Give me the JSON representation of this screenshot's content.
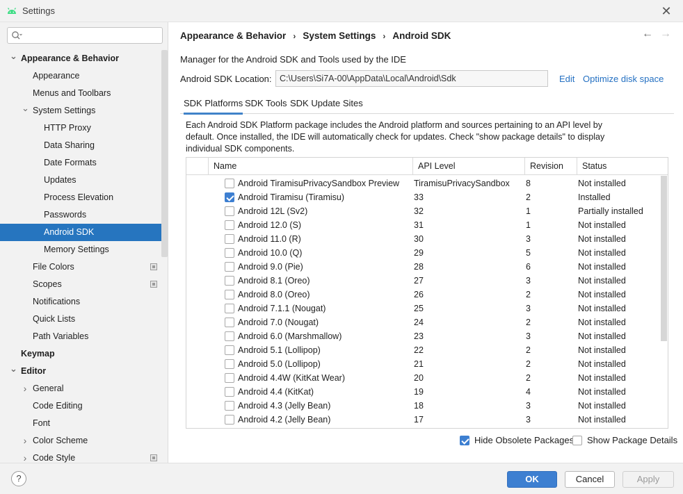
{
  "window": {
    "title": "Settings",
    "close_glyph": "✕"
  },
  "search": {
    "placeholder": "",
    "value": ""
  },
  "sidebar": {
    "items": [
      {
        "label": "Appearance & Behavior",
        "level": 0,
        "arrow": "expanded",
        "bold": true
      },
      {
        "label": "Appearance",
        "level": 1
      },
      {
        "label": "Menus and Toolbars",
        "level": 1
      },
      {
        "label": "System Settings",
        "level": 1,
        "arrow": "expanded"
      },
      {
        "label": "HTTP Proxy",
        "level": 2
      },
      {
        "label": "Data Sharing",
        "level": 2
      },
      {
        "label": "Date Formats",
        "level": 2
      },
      {
        "label": "Updates",
        "level": 2
      },
      {
        "label": "Process Elevation",
        "level": 2
      },
      {
        "label": "Passwords",
        "level": 2
      },
      {
        "label": "Android SDK",
        "level": 2,
        "selected": true
      },
      {
        "label": "Memory Settings",
        "level": 2
      },
      {
        "label": "File Colors",
        "level": 1,
        "badge": true
      },
      {
        "label": "Scopes",
        "level": 1,
        "badge": true
      },
      {
        "label": "Notifications",
        "level": 1
      },
      {
        "label": "Quick Lists",
        "level": 1
      },
      {
        "label": "Path Variables",
        "level": 1
      },
      {
        "label": "Keymap",
        "level": 0,
        "bold": true
      },
      {
        "label": "Editor",
        "level": 0,
        "arrow": "expanded",
        "bold": true
      },
      {
        "label": "General",
        "level": 1,
        "arrow": "collapsed"
      },
      {
        "label": "Code Editing",
        "level": 1
      },
      {
        "label": "Font",
        "level": 1
      },
      {
        "label": "Color Scheme",
        "level": 1,
        "arrow": "collapsed"
      },
      {
        "label": "Code Style",
        "level": 1,
        "arrow": "collapsed",
        "badge": true
      }
    ]
  },
  "breadcrumb": {
    "part1": "Appearance & Behavior",
    "part2": "System Settings",
    "part3": "Android SDK",
    "sep": "›"
  },
  "nav": {
    "back": "←",
    "forward": "→"
  },
  "main": {
    "description": "Manager for the Android SDK and Tools used by the IDE",
    "location_label": "Android SDK Location:",
    "location_value": "C:\\Users\\Si7A-00\\AppData\\Local\\Android\\Sdk",
    "edit_link": "Edit",
    "optimize_link": "Optimize disk space",
    "tabs": [
      "SDK Platforms",
      "SDK Tools",
      "SDK Update Sites"
    ],
    "panel_description": "Each Android SDK Platform package includes the Android platform and sources pertaining to an API level by default. Once installed, the IDE will automatically check for updates. Check \"show package details\" to display individual SDK components."
  },
  "table": {
    "columns": [
      "Name",
      "API Level",
      "Revision",
      "Status"
    ],
    "rows": [
      {
        "checked": false,
        "name": "Android TiramisuPrivacySandbox Preview",
        "api": "TiramisuPrivacySandbox",
        "revision": "8",
        "status": "Not installed"
      },
      {
        "checked": true,
        "name": "Android Tiramisu (Tiramisu)",
        "api": "33",
        "revision": "2",
        "status": "Installed"
      },
      {
        "checked": false,
        "name": "Android 12L (Sv2)",
        "api": "32",
        "revision": "1",
        "status": "Partially installed"
      },
      {
        "checked": false,
        "name": "Android 12.0 (S)",
        "api": "31",
        "revision": "1",
        "status": "Not installed"
      },
      {
        "checked": false,
        "name": "Android 11.0 (R)",
        "api": "30",
        "revision": "3",
        "status": "Not installed"
      },
      {
        "checked": false,
        "name": "Android 10.0 (Q)",
        "api": "29",
        "revision": "5",
        "status": "Not installed"
      },
      {
        "checked": false,
        "name": "Android 9.0 (Pie)",
        "api": "28",
        "revision": "6",
        "status": "Not installed"
      },
      {
        "checked": false,
        "name": "Android 8.1 (Oreo)",
        "api": "27",
        "revision": "3",
        "status": "Not installed"
      },
      {
        "checked": false,
        "name": "Android 8.0 (Oreo)",
        "api": "26",
        "revision": "2",
        "status": "Not installed"
      },
      {
        "checked": false,
        "name": "Android 7.1.1 (Nougat)",
        "api": "25",
        "revision": "3",
        "status": "Not installed"
      },
      {
        "checked": false,
        "name": "Android 7.0 (Nougat)",
        "api": "24",
        "revision": "2",
        "status": "Not installed"
      },
      {
        "checked": false,
        "name": "Android 6.0 (Marshmallow)",
        "api": "23",
        "revision": "3",
        "status": "Not installed"
      },
      {
        "checked": false,
        "name": "Android 5.1 (Lollipop)",
        "api": "22",
        "revision": "2",
        "status": "Not installed"
      },
      {
        "checked": false,
        "name": "Android 5.0 (Lollipop)",
        "api": "21",
        "revision": "2",
        "status": "Not installed"
      },
      {
        "checked": false,
        "name": "Android 4.4W (KitKat Wear)",
        "api": "20",
        "revision": "2",
        "status": "Not installed"
      },
      {
        "checked": false,
        "name": "Android 4.4 (KitKat)",
        "api": "19",
        "revision": "4",
        "status": "Not installed"
      },
      {
        "checked": false,
        "name": "Android 4.3 (Jelly Bean)",
        "api": "18",
        "revision": "3",
        "status": "Not installed"
      },
      {
        "checked": false,
        "name": "Android 4.2 (Jelly Bean)",
        "api": "17",
        "revision": "3",
        "status": "Not installed"
      }
    ]
  },
  "options": {
    "hide_obsolete": {
      "label": "Hide Obsolete Packages",
      "checked": true
    },
    "show_details": {
      "label": "Show Package Details",
      "checked": false
    }
  },
  "footer": {
    "help": "?",
    "ok": "OK",
    "cancel": "Cancel",
    "apply": "Apply"
  },
  "colors": {
    "accent": "#2675bf",
    "link": "#2470c2",
    "sidebar_bg": "#f2f2f2",
    "android_green": "#3ddc84"
  }
}
